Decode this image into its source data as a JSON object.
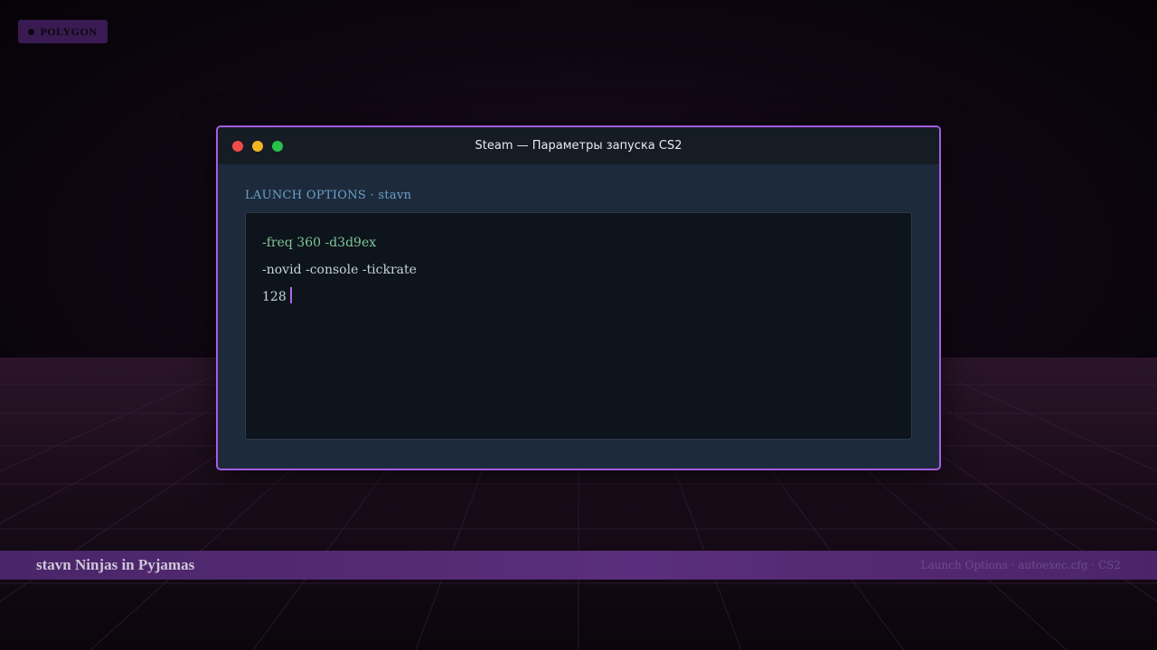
{
  "brand": {
    "label": "POLYGON"
  },
  "window": {
    "title": "Steam — Параметры запуска CS2",
    "controls": [
      "close",
      "minimize",
      "maximize"
    ],
    "section_label": "LAUNCH OPTIONS · stavn",
    "editor": {
      "lines": [
        "-freq 360 -d3d9ex",
        "-novid -console -tickrate",
        "128"
      ]
    }
  },
  "footer": {
    "left_text": "stavn Ninjas in Pyjamas",
    "right_text": "Launch Options · autoexec.cfg · CS2"
  },
  "colors": {
    "accent": "#a45de0",
    "code_green": "#7fc79a",
    "bar_purple": "#5a2e7c"
  }
}
